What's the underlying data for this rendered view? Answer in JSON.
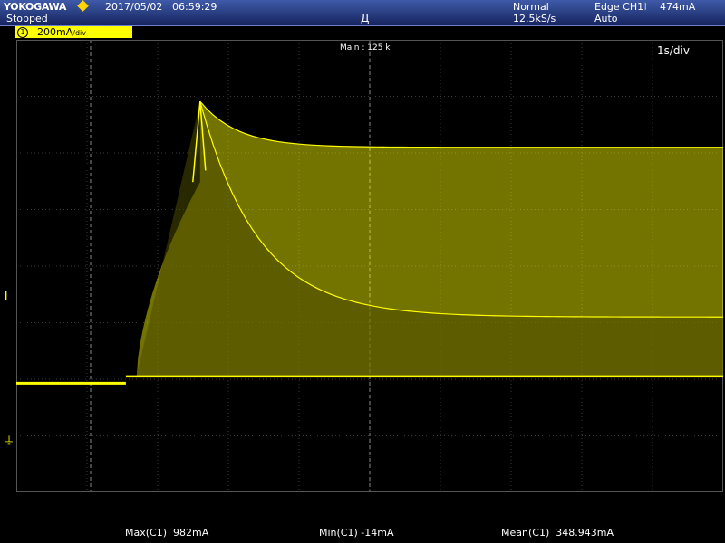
{
  "header": {
    "brand": "YOKOGAWA",
    "status": "Stopped",
    "date": "2017/05/02",
    "time": "06:59:29",
    "acq_mode": "Normal",
    "sample_rate": "12.5kS/s",
    "trigger_type": "Edge CH1",
    "trigger_level": "474mA",
    "trigger_mode": "Auto",
    "trigger_pos_mark": "Д"
  },
  "channel": {
    "number": "1",
    "scale": "200mA",
    "unit_suffix": "/div",
    "marker": "I",
    "ground_symbol": "⏚",
    "color": "#ffff00"
  },
  "display": {
    "main_label": "Main : 125 k",
    "timebase": "1s/div",
    "grid_divisions": {
      "x": 10,
      "y": 8
    }
  },
  "measurements": [
    {
      "label": "Max(C1)",
      "value": "982mA"
    },
    {
      "label": "Min(C1)",
      "value": "-14mA"
    },
    {
      "label": "Mean(C1)",
      "value": "348.943mA"
    }
  ],
  "waveform": {
    "baseline_mA": -14,
    "step_mA": 10,
    "peak_mA": 982,
    "upper_band_mA": 820,
    "lower_band_mA": 220,
    "step_time_div": 1.55,
    "rise_start_div": 1.7,
    "peak_time_div": 2.6,
    "zero_offset_div": 2.0,
    "vertical_scale_mA_per_div": 200
  }
}
